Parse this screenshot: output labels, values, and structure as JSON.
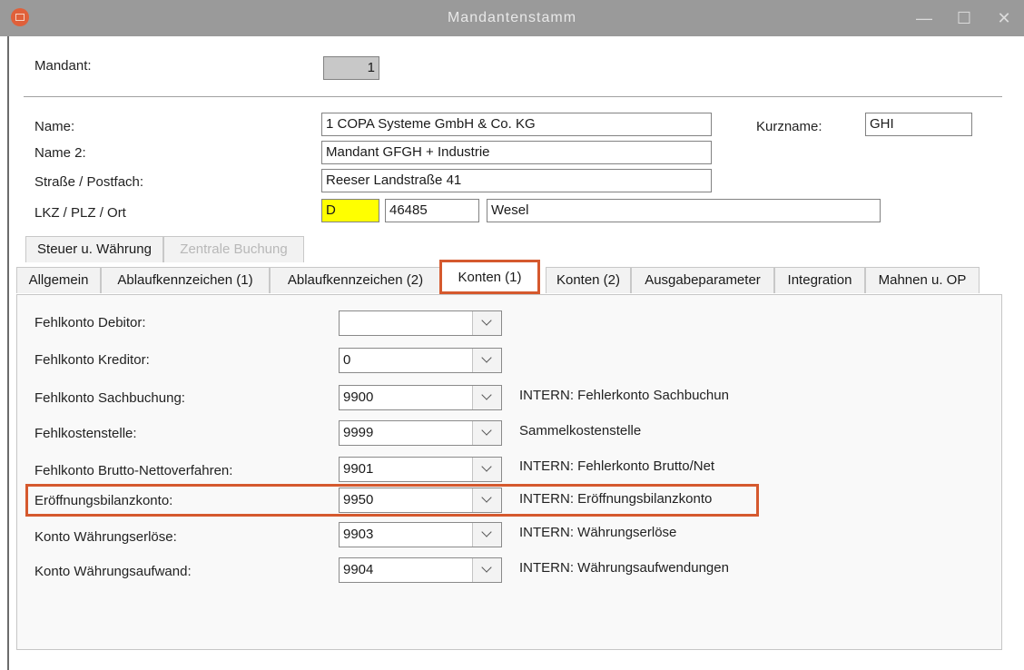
{
  "window": {
    "title": "Mandantenstamm",
    "minimize_glyph": "—",
    "maximize_glyph": "☐",
    "close_glyph": "✕"
  },
  "header": {
    "mandant_label": "Mandant:",
    "mandant_value": "1",
    "name_label": "Name:",
    "name_value": "1 COPA Systeme GmbH & Co. KG",
    "kurzname_label": "Kurzname:",
    "kurzname_value": "GHI",
    "name2_label": "Name 2:",
    "name2_value": "Mandant GFGH + Industrie",
    "strasse_label": "Straße / Postfach:",
    "strasse_value": "Reeser Landstraße 41",
    "lkz_label": "LKZ / PLZ / Ort",
    "lkz_value": "D",
    "plz_value": "46485",
    "ort_value": "Wesel"
  },
  "tabs_row1": [
    "Steuer u. Währung",
    "Zentrale Buchung"
  ],
  "tabs_row2": [
    "Allgemein",
    "Ablaufkennzeichen (1)",
    "Ablaufkennzeichen (2)",
    "Konten (1)",
    "Konten (2)",
    "Ausgabeparameter",
    "Integration",
    "Mahnen u. OP"
  ],
  "konten": [
    {
      "label": "Fehlkonto Debitor:",
      "value": "",
      "desc": ""
    },
    {
      "label": "Fehlkonto Kreditor:",
      "value": "0",
      "desc": ""
    },
    {
      "label": "Fehlkonto Sachbuchung:",
      "value": "9900",
      "desc": "INTERN: Fehlerkonto Sachbuchun"
    },
    {
      "label": "Fehlkostenstelle:",
      "value": "9999",
      "desc": "Sammelkostenstelle"
    },
    {
      "label": "Fehlkonto Brutto-Nettoverfahren:",
      "value": "9901",
      "desc": "INTERN: Fehlerkonto Brutto/Net"
    },
    {
      "label": "Eröffnungsbilanzkonto:",
      "value": "9950",
      "desc": "INTERN: Eröffnungsbilanzkonto"
    },
    {
      "label": "Konto Währungserlöse:",
      "value": "9903",
      "desc": "INTERN: Währungserlöse"
    },
    {
      "label": "Konto Währungsaufwand:",
      "value": "9904",
      "desc": "INTERN: Währungsaufwendungen"
    }
  ],
  "colors": {
    "highlight": "#d5592e",
    "lkz_field": "#ffff00",
    "titlebar": "#9a9a9a"
  }
}
